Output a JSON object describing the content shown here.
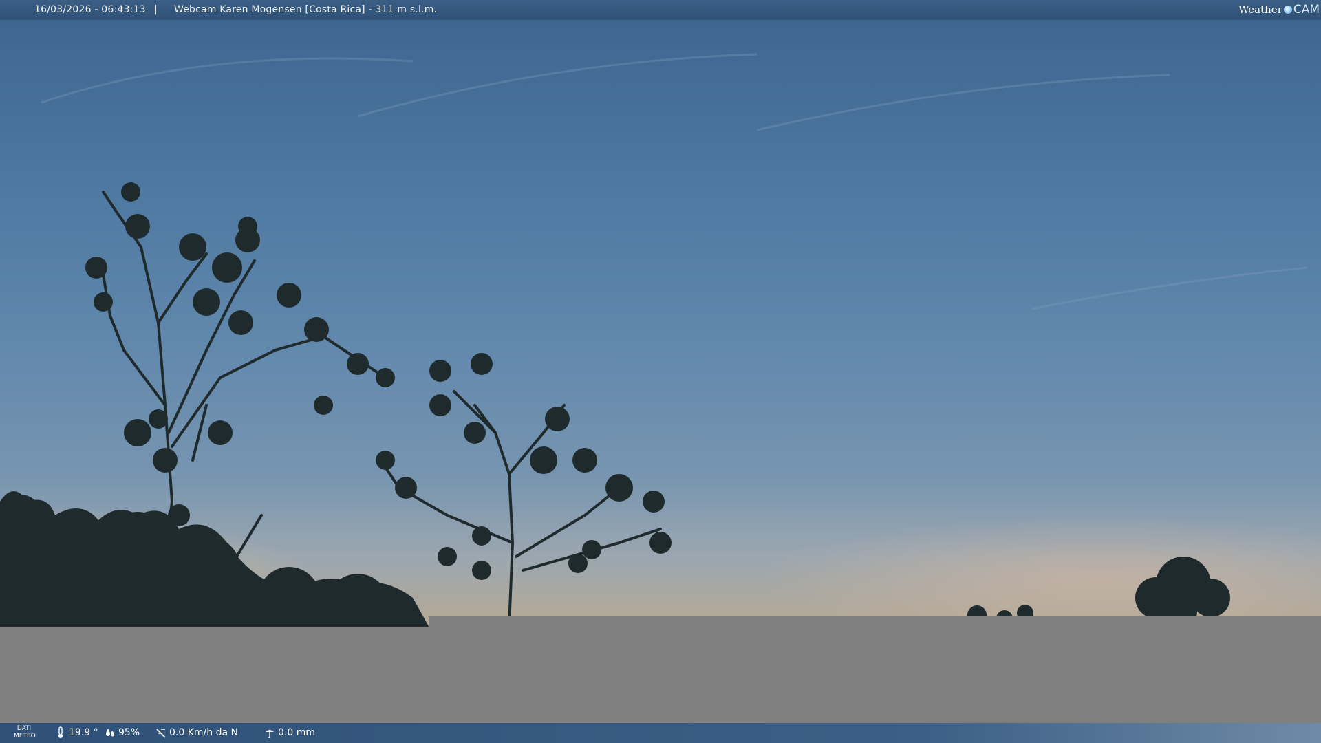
{
  "header": {
    "timestamp": "16/03/2026 - 06:43:13",
    "separator": "|",
    "title": "Webcam Karen Mogensen [Costa Rica] - 311 m s.l.m.",
    "logo_word": "Weather",
    "logo_cam": "CAM"
  },
  "weather": {
    "label": "DATI METEO",
    "temperature": "19.9 °",
    "humidity": "95%",
    "wind": "0.0 Km/h da N",
    "rain": "0.0 mm",
    "icons": [
      "thermometer-icon",
      "humidity-icon",
      "wind-icon",
      "rain-icon"
    ]
  },
  "colors": {
    "bar": "#2f5178",
    "mask": "#808080",
    "sky_top": "#3f6690",
    "sky_horizon": "#b7aa95"
  }
}
